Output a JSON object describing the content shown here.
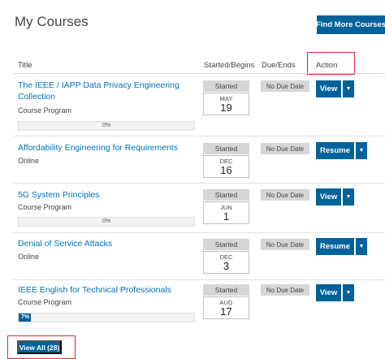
{
  "page": {
    "title": "My Courses",
    "find_more_label": "Find More Courses"
  },
  "table": {
    "headers": {
      "title": "Title",
      "started": "Started/Begins",
      "due": "Due/Ends",
      "action": "Action"
    }
  },
  "courses": [
    {
      "title": "The IEEE / IAPP Data Privacy Engineering Collection",
      "type": "Course Program",
      "started_label": "Started",
      "month": "MAY",
      "day": "19",
      "due": "No Due Date",
      "action": "View",
      "progress_text": "0%",
      "progress": 0
    },
    {
      "title": "Affordability Engineering for Requirements",
      "type": "Online",
      "started_label": "Started",
      "month": "DEC",
      "day": "16",
      "due": "No Due Date",
      "action": "Resume"
    },
    {
      "title": "5G System Principles",
      "type": "Course Program",
      "started_label": "Started",
      "month": "JUN",
      "day": "1",
      "due": "No Due Date",
      "action": "View",
      "progress_text": "0%",
      "progress": 0
    },
    {
      "title": "Denial of Service Attacks",
      "type": "Online",
      "started_label": "Started",
      "month": "DEC",
      "day": "3",
      "due": "No Due Date",
      "action": "Resume"
    },
    {
      "title": "IEEE English for Technical Professionals",
      "type": "Course Program",
      "started_label": "Started",
      "month": "AUG",
      "day": "17",
      "due": "No Due Date",
      "action": "View",
      "progress_text": "7%",
      "progress": 7
    }
  ],
  "footer": {
    "view_all_label": "View All (28)"
  },
  "colors": {
    "primary": "#00629b",
    "link": "#0072b5",
    "highlight": "#d9282f"
  },
  "icons": {
    "dropdown": "caret-down-icon"
  }
}
